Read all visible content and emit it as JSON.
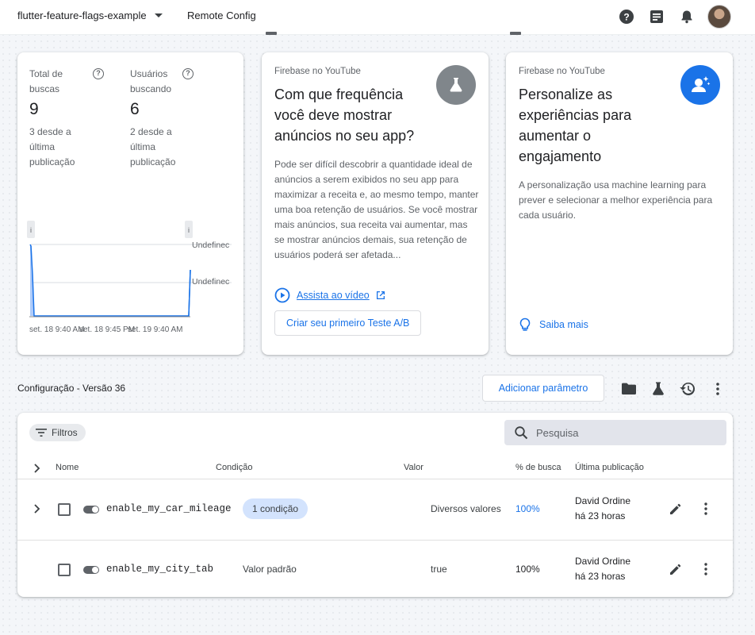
{
  "header": {
    "project": "flutter-feature-flags-example",
    "product": "Remote Config",
    "icons": [
      "help-icon",
      "notes-icon",
      "bell-icon",
      "avatar"
    ]
  },
  "stats": {
    "total_searches": {
      "label": "Total de buscas",
      "value": "9",
      "sub": "3 desde a última publicação"
    },
    "users_searching": {
      "label": "Usuários buscando",
      "value": "6",
      "sub": "2 desde a última publicação"
    },
    "chart_labels": {
      "undefined_top": "Undefinec",
      "undefined_bottom": "Undefinec",
      "x_ticks": [
        "set. 18 9:40 AM",
        "set. 18 9:45 PM",
        "set. 19 9:40 AM"
      ]
    }
  },
  "card_ads": {
    "kicker": "Firebase no YouTube",
    "title": "Com que frequência você deve mostrar anúncios no seu app?",
    "body": "Pode ser difícil descobrir a quantidade ideal de anúncios a serem exibidos no seu app para maximizar a receita e, ao mesmo tempo, manter uma boa retenção de usuários. Se você mostrar mais anúncios, sua receita vai aumentar, mas se mostrar anúncios demais, sua retenção de usuários poderá ser afetada...",
    "watch_link": "Assista ao vídeo",
    "cta": "Criar seu primeiro Teste A/B",
    "icon": "flask-icon",
    "icon_bg": "#80868b"
  },
  "card_personalize": {
    "kicker": "Firebase no YouTube",
    "title": "Personalize as experiências para aumentar o engajamento",
    "body": "A personalização usa machine learning para prever e selecionar a melhor experiência para cada usuário.",
    "learn_more": "Saiba mais",
    "icon": "person-sparkle-icon",
    "icon_bg": "#1a73e8"
  },
  "config": {
    "title": "Configuração - Versão 36",
    "add_param": "Adicionar parâmetro",
    "filters": "Filtros",
    "search_placeholder": "Pesquisa",
    "columns": {
      "name": "Nome",
      "condition": "Condição",
      "value": "Valor",
      "fetch_pct": "% de busca",
      "last_published": "Última publicação"
    },
    "rows": [
      {
        "key": "enable_my_car_mileage",
        "condition": "1 condição",
        "value": "Diversos valores",
        "fetch_pct": "100%",
        "publisher": "David Ordine",
        "published": "há 23 horas"
      },
      {
        "key": "enable_my_city_tab",
        "condition": "Valor padrão",
        "value": "true",
        "fetch_pct": "100%",
        "publisher": "David Ordine",
        "published": "há 23 horas"
      }
    ]
  },
  "colors": {
    "accent": "#1a73e8",
    "chart_line": "#1a73e8",
    "pill": "#d3e3fd"
  }
}
